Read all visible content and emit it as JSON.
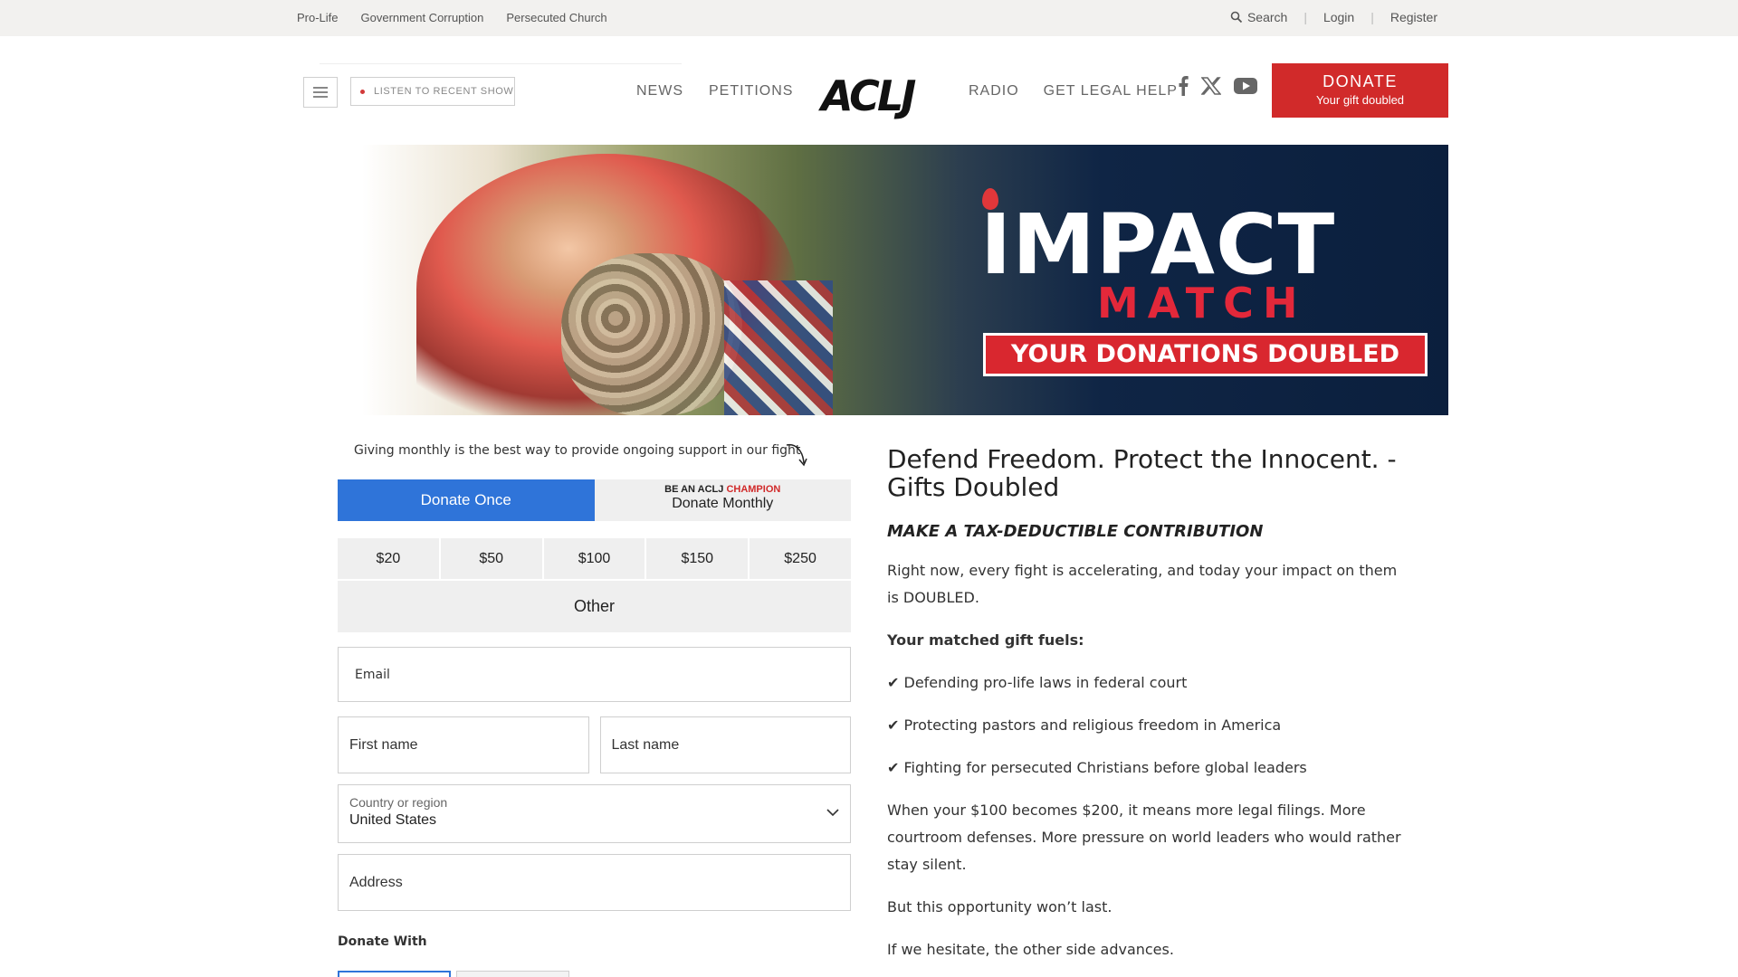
{
  "utility": {
    "left_links": [
      "Pro-Life",
      "Government Corruption",
      "Persecuted Church"
    ],
    "search_label": "Search",
    "login_label": "Login",
    "register_label": "Register",
    "separator": "|"
  },
  "header": {
    "listen_label": "LISTEN TO RECENT SHOW",
    "nav_left": [
      "NEWS",
      "PETITIONS"
    ],
    "logo_text": "ACLJ",
    "nav_right": [
      "RADIO",
      "GET LEGAL HELP"
    ],
    "socials": [
      "facebook-icon",
      "x-icon",
      "youtube-icon"
    ],
    "donate_label": "DONATE",
    "donate_sub": "Your gift doubled"
  },
  "hero": {
    "title": "IMPACT",
    "subtitle": "MATCH",
    "banner": "YOUR DONATIONS DOUBLED",
    "colors": {
      "navy": "#0b1f3d",
      "red": "#d9272f"
    }
  },
  "form": {
    "giving_note": "Giving monthly is the best way to provide ongoing support in our fight",
    "once_label": "Donate Once",
    "monthly_kicker": "BE AN ACLJ",
    "monthly_kicker_accent": "CHAMPION",
    "monthly_label": "Donate Monthly",
    "amounts": [
      "$20",
      "$50",
      "$100",
      "$150",
      "$250"
    ],
    "other_label": "Other",
    "email_placeholder": "Email",
    "first_name_placeholder": "First name",
    "last_name_placeholder": "Last name",
    "country_label": "Country or region",
    "country_value": "United States",
    "address_placeholder": "Address",
    "donate_with_label": "Donate With",
    "colors": {
      "primary": "#2f74d9",
      "accent": "#d12a2a"
    }
  },
  "content": {
    "heading": "Defend Freedom. Protect the Innocent. - Gifts Doubled",
    "subheading": "MAKE A TAX-DEDUCTIBLE CONTRIBUTION",
    "p1": "Right now, every fight is accelerating, and today your impact on them is DOUBLED.",
    "fuels": "Your matched gift fuels:",
    "bullets": [
      "✔ Defending pro-life laws in federal court",
      "✔ Protecting pastors and religious freedom in America",
      "✔ Fighting for persecuted Christians before global leaders"
    ],
    "p2": "When your $100 becomes $200, it means more legal filings. More courtroom defenses. More pressure on world leaders who would rather stay silent.",
    "p3": "But this opportunity won’t last.",
    "p4": "If we hesitate, the other side advances."
  }
}
